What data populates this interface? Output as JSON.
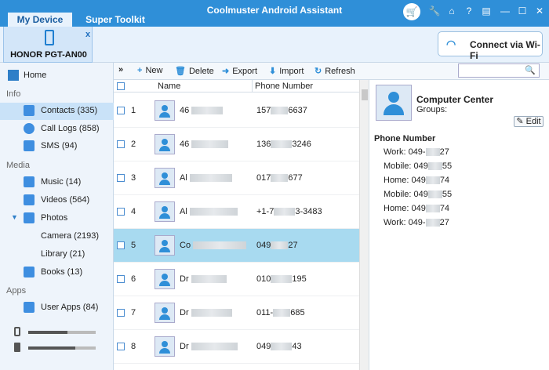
{
  "app": {
    "title": "Coolmuster Android Assistant",
    "tabs": [
      "My Device",
      "Super Toolkit"
    ],
    "window_buttons": [
      "🔧",
      "⌂",
      "?",
      "▤",
      "—",
      "☐",
      "✕"
    ]
  },
  "device": {
    "name": "HONOR PGT-AN00",
    "close": "x",
    "wifi_label": "Connect via Wi-Fi"
  },
  "sidebar": {
    "home": "Home",
    "sections": {
      "info": "Info",
      "media": "Media",
      "apps": "Apps"
    },
    "items": {
      "contacts": "Contacts (335)",
      "calllogs": "Call Logs (858)",
      "sms": "SMS (94)",
      "music": "Music (14)",
      "videos": "Videos (564)",
      "photos": "Photos",
      "camera": "Camera (2193)",
      "library": "Library (21)",
      "books": "Books (13)",
      "userapps": "User Apps (84)"
    }
  },
  "toolbar": {
    "collapse": "»",
    "new": "New",
    "delete": "Delete",
    "export": "Export",
    "import": "Import",
    "refresh": "Refresh"
  },
  "grid": {
    "col_name": "Name",
    "col_phone": "Phone Number",
    "rows": [
      {
        "num": "1",
        "name": "46",
        "phone_a": "157",
        "phone_b": "6637"
      },
      {
        "num": "2",
        "name": "46",
        "phone_a": "136",
        "phone_b": "3246"
      },
      {
        "num": "3",
        "name": "Al",
        "phone_a": "017",
        "phone_b": "677"
      },
      {
        "num": "4",
        "name": "Al",
        "phone_a": "+1-7",
        "phone_b": "3-3483"
      },
      {
        "num": "5",
        "name": "Co",
        "phone_a": "049",
        "phone_b": "27"
      },
      {
        "num": "6",
        "name": "Dr",
        "phone_a": "010",
        "phone_b": "195"
      },
      {
        "num": "7",
        "name": "Dr",
        "phone_a": "011-",
        "phone_b": "685"
      },
      {
        "num": "8",
        "name": "Dr",
        "phone_a": "049",
        "phone_b": "43"
      }
    ]
  },
  "detail": {
    "name": "Computer Center",
    "groups": "Groups:",
    "edit": "Edit",
    "phone_header": "Phone Number",
    "phones": [
      {
        "label": "Work: 049-",
        "tail": "27"
      },
      {
        "label": "Mobile: 049",
        "tail": "55"
      },
      {
        "label": "Home: 049",
        "tail": "74"
      },
      {
        "label": "Mobile: 049",
        "tail": "55"
      },
      {
        "label": "Home: 049",
        "tail": "74"
      },
      {
        "label": "Work: 049-",
        "tail": "27"
      }
    ]
  },
  "colors": {
    "accent": "#2f8fd8",
    "selected_row": "#a8daf0",
    "sidebar_bg": "#eef4fb"
  }
}
